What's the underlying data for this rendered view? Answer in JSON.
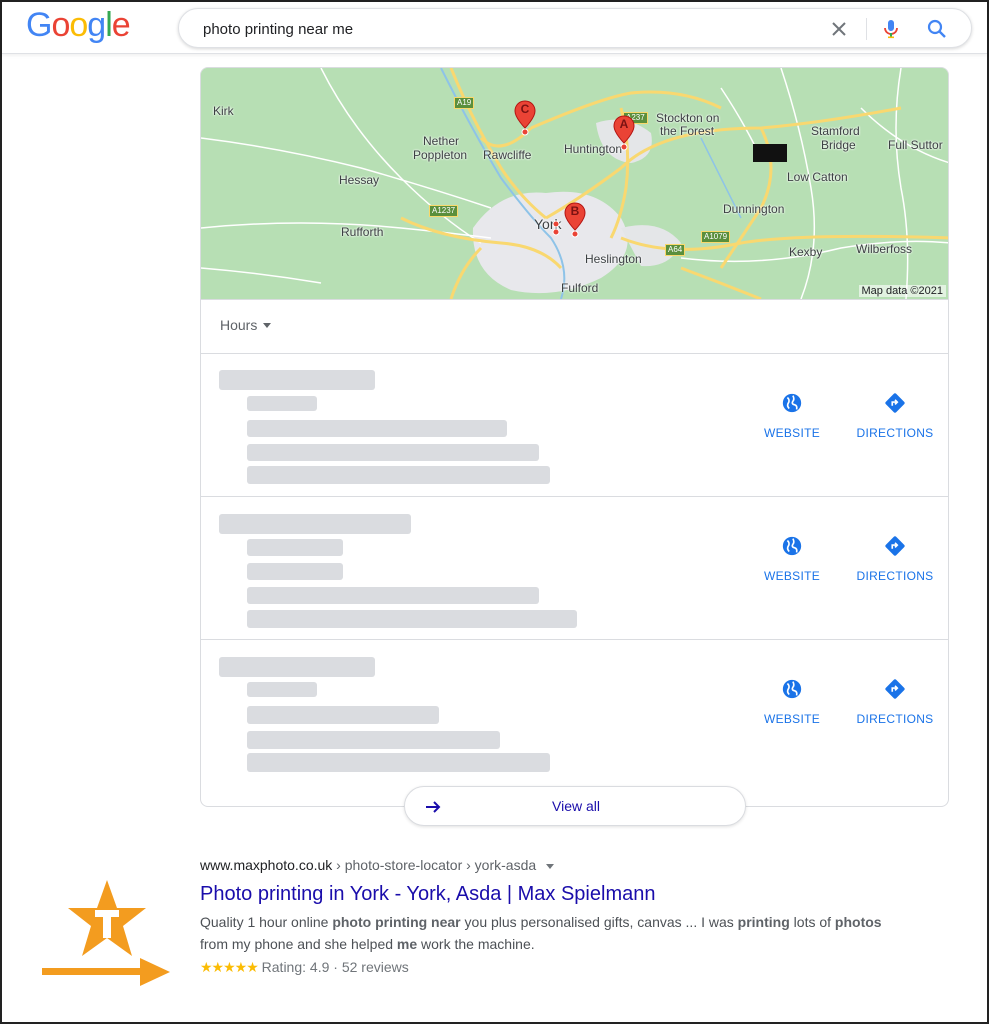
{
  "header": {
    "logo_letters": [
      {
        "ch": "G",
        "color": "#4285F4"
      },
      {
        "ch": "o",
        "color": "#EA4335"
      },
      {
        "ch": "o",
        "color": "#FBBC05"
      },
      {
        "ch": "g",
        "color": "#4285F4"
      },
      {
        "ch": "l",
        "color": "#34A853"
      },
      {
        "ch": "e",
        "color": "#EA4335"
      }
    ],
    "search_value": "photo printing near me",
    "icons": {
      "clear": "close-icon",
      "mic": "microphone-icon",
      "search": "search-icon"
    }
  },
  "map": {
    "labels": {
      "kirk": "Kirk",
      "nether": "Nether",
      "poppleton": "Poppleton",
      "rawcliffe": "Rawcliffe",
      "huntington": "Huntington",
      "stockton1": "Stockton on",
      "stockton2": "the Forest",
      "stamford1": "Stamford",
      "stamford2": "Bridge",
      "full_sutton": "Full Suttor",
      "hessay": "Hessay",
      "low_catton": "Low Catton",
      "dunnington": "Dunnington",
      "rufforth": "Rufforth",
      "york": "York",
      "heslington": "Heslington",
      "kexby": "Kexby",
      "wilberfoss": "Wilberfoss",
      "fulford": "Fulford"
    },
    "roads": {
      "a19": "A19",
      "a237": "A237",
      "a1237": "A1237",
      "a64": "A64",
      "a1079": "A1079"
    },
    "pins": {
      "a": "A",
      "b": "B",
      "c": "C"
    },
    "credit": "Map data ©2021"
  },
  "hours_filter": "Hours",
  "listings": [
    {
      "website": "WEBSITE",
      "directions": "DIRECTIONS"
    },
    {
      "website": "WEBSITE",
      "directions": "DIRECTIONS"
    },
    {
      "website": "WEBSITE",
      "directions": "DIRECTIONS"
    }
  ],
  "view_all": "View all",
  "result": {
    "domain": "www.maxphoto.co.uk",
    "path": " › photo-store-locator › york-asda",
    "title": "Photo printing in York - York, Asda | Max Spielmann",
    "snippet_parts": [
      {
        "t": "Quality 1 hour online ",
        "b": false
      },
      {
        "t": "photo printing near",
        "b": true
      },
      {
        "t": " you plus personalised gifts, canvas ... I was ",
        "b": false
      },
      {
        "t": "printing",
        "b": true
      },
      {
        "t": " lots of ",
        "b": false
      },
      {
        "t": "photos",
        "b": true
      },
      {
        "t": " from my phone and she helped ",
        "b": false
      },
      {
        "t": "me",
        "b": true
      },
      {
        "t": " work the machine.",
        "b": false
      }
    ],
    "stars": "★★★★★",
    "rating": "Rating: 4.9",
    "sep": " · ",
    "reviews": "52 reviews"
  },
  "colors": {
    "link": "#1a0dab",
    "action": "#1a73e8",
    "accent_arrow": "#f39c1f",
    "pin": "#ea4335"
  }
}
